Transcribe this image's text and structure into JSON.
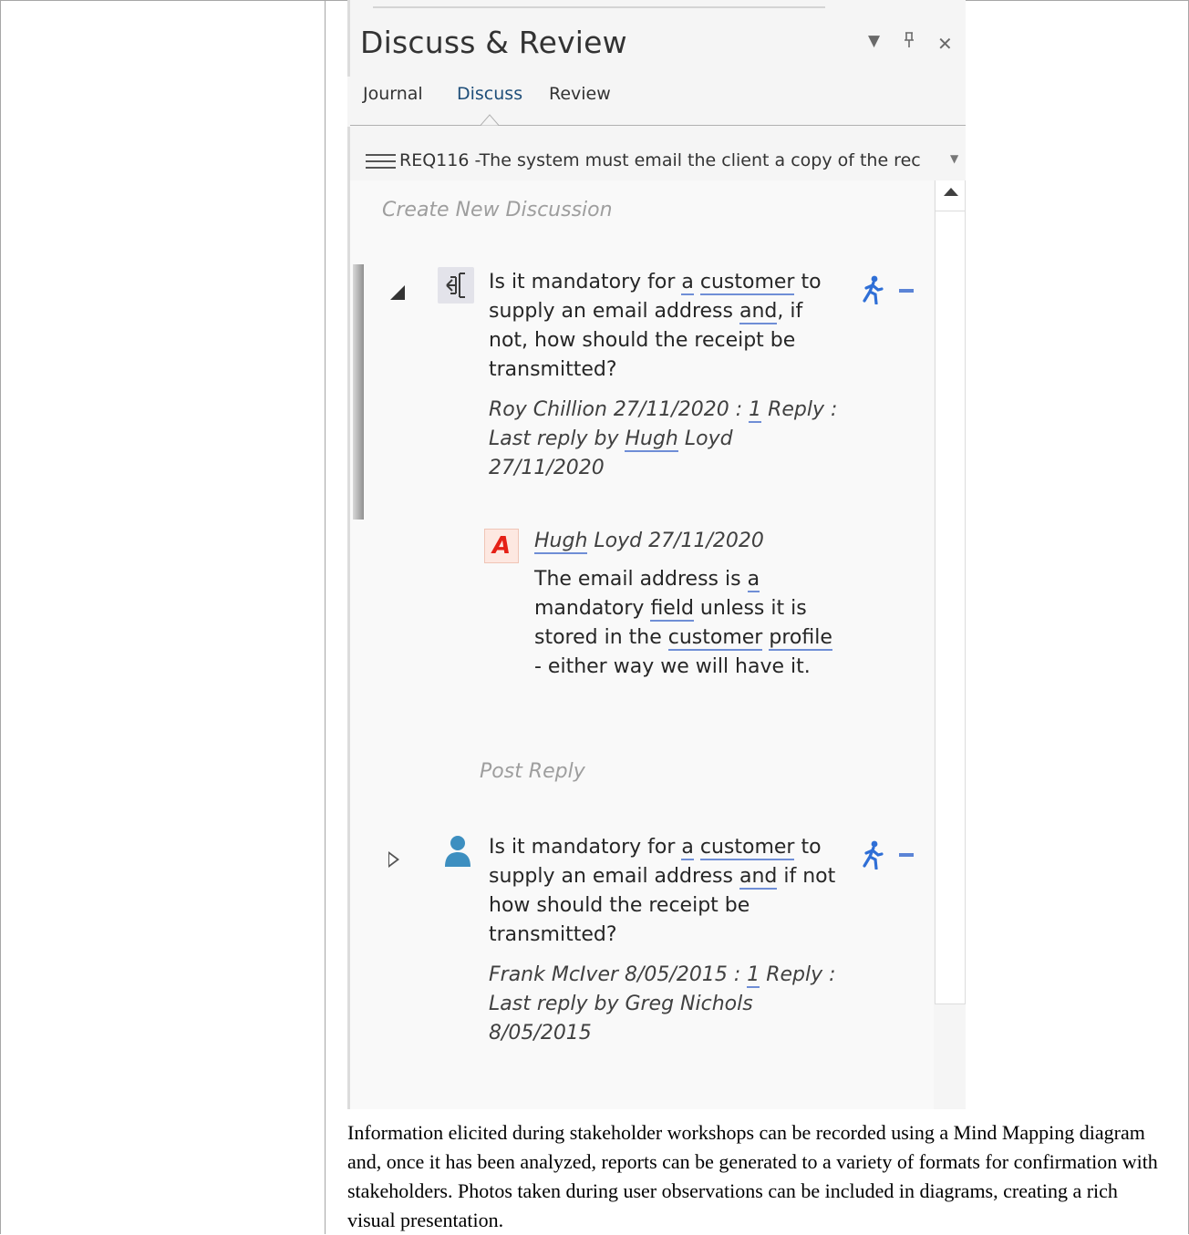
{
  "panel": {
    "title": "Discuss & Review",
    "window_buttons": {
      "dropdown": "▾",
      "pin": "ᵖ",
      "close": "✕"
    },
    "tabs": [
      {
        "label": "Journal",
        "active": false
      },
      {
        "label": "Discuss",
        "active": true
      },
      {
        "label": "Review",
        "active": false
      }
    ],
    "topic": "REQ116 -The system must email the client a copy of the rec",
    "create_new": "Create New Discussion",
    "post_reply": "Post Reply"
  },
  "threads": [
    {
      "state": "expanded",
      "icon": "requirement-icon",
      "message": {
        "p1": "Is it mandatory for ",
        "u1": "a",
        "p2": " ",
        "u2": "customer",
        "p3": " to supply an email address ",
        "u3": "and",
        "p4": ", if not, how should the receipt be transmitted?"
      },
      "meta": {
        "p1": "Roy Chillion 27/11/2020 : ",
        "u1": "1",
        "p2": " Reply : Last reply by ",
        "u2": "Hugh",
        "p3": " Loyd 27/11/2020"
      },
      "reply": {
        "icon": "author-icon",
        "icon_letter": "A",
        "author": "Hugh",
        "author_rest": " Loyd  27/11/2020",
        "p1": "The email address is ",
        "u1": "a",
        "p2": " mandatory ",
        "u2": "field",
        "p3": " unless it is stored in the ",
        "u3": "customer",
        "p4": " ",
        "u4": "profile",
        "p5": " - either way we will have it."
      }
    },
    {
      "state": "collapsed",
      "icon": "user-icon",
      "message": {
        "p1": "Is it mandatory for ",
        "u1": "a",
        "p2": " ",
        "u2": "customer",
        "p3": " to supply an email address ",
        "u3": "and",
        "p4": " if not how should the receipt be transmitted?"
      },
      "meta": {
        "p1": "Frank McIver 8/05/2015 : ",
        "u1": "1",
        "p2": " Reply : Last reply by Greg Nichols 8/05/2015"
      }
    }
  ],
  "description": "Information elicited during stakeholder workshops can be recorded using a Mind Mapping diagram and, once it has been analyzed, reports can be generated to a variety of formats for confirmation with stakeholders. Photos taken during user observations can be included in diagrams, creating a rich visual presentation.",
  "colors": {
    "accent": "#1e4e79",
    "status_icon": "#2f6fd6",
    "underline": "#6f8ed6"
  }
}
